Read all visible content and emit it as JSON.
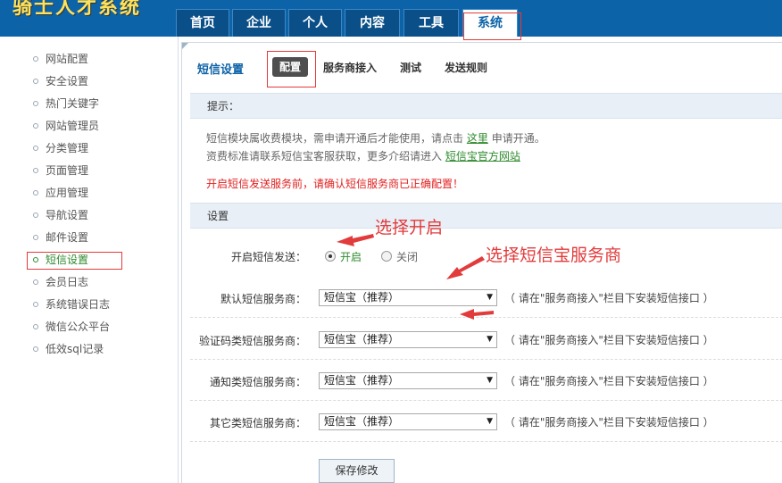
{
  "app": {
    "logo_text": "骑士人才系统"
  },
  "nav": {
    "tabs": [
      {
        "label": "首页"
      },
      {
        "label": "企业"
      },
      {
        "label": "个人"
      },
      {
        "label": "内容"
      },
      {
        "label": "工具"
      },
      {
        "label": "系统",
        "active": true
      }
    ]
  },
  "sidebar": {
    "items": [
      {
        "label": "网站配置"
      },
      {
        "label": "安全设置"
      },
      {
        "label": "热门关键字"
      },
      {
        "label": "网站管理员"
      },
      {
        "label": "分类管理"
      },
      {
        "label": "页面管理"
      },
      {
        "label": "应用管理"
      },
      {
        "label": "导航设置"
      },
      {
        "label": "邮件设置"
      },
      {
        "label": "短信设置",
        "active": true
      },
      {
        "label": "会员日志"
      },
      {
        "label": "系统错误日志"
      },
      {
        "label": "微信公众平台"
      },
      {
        "label": "低效sql记录"
      }
    ]
  },
  "main": {
    "title": "短信设置",
    "subtabs": [
      {
        "label": "配置",
        "active": true
      },
      {
        "label": "服务商接入"
      },
      {
        "label": "测试"
      },
      {
        "label": "发送规则"
      }
    ],
    "tips": {
      "heading": "提示：",
      "line1_a": "短信模块属收费模块，需申请开通后才能使用，请点击",
      "line1_link": "这里",
      "line1_b": "申请开通。",
      "line2_a": "资费标准请联系短信宝客服获取，更多介绍请进入",
      "line2_link": "短信宝官方网站",
      "warning": "开启短信发送服务前，请确认短信服务商已正确配置！"
    },
    "settings": {
      "heading": "设置",
      "enable_label": "开启短信发送：",
      "enable_on": "开启",
      "enable_off": "关闭",
      "enabled": true,
      "rows": [
        {
          "label": "默认短信服务商：",
          "value": "短信宝（推荐）",
          "hint": "（ 请在\"服务商接入\"栏目下安装短信接口 ）"
        },
        {
          "label": "验证码类短信服务商：",
          "value": "短信宝（推荐）",
          "hint": "（ 请在\"服务商接入\"栏目下安装短信接口 ）"
        },
        {
          "label": "通知类短信服务商：",
          "value": "短信宝（推荐）",
          "hint": "（ 请在\"服务商接入\"栏目下安装短信接口 ）"
        },
        {
          "label": "其它类短信服务商：",
          "value": "短信宝（推荐）",
          "hint": "（ 请在\"服务商接入\"栏目下安装短信接口 ）"
        }
      ],
      "save_label": "保存修改"
    }
  },
  "annotations": {
    "choose_on": "选择开启",
    "choose_provider": "选择短信宝服务商",
    "color": "#e23b3b"
  }
}
